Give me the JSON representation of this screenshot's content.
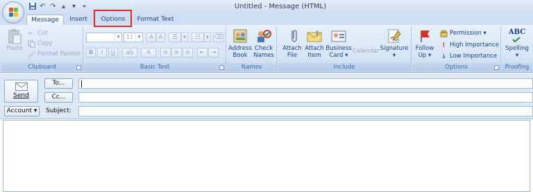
{
  "window": {
    "title": "Untitled - Message (HTML)"
  },
  "quick_access": {
    "icons": [
      "save-icon",
      "undo-icon",
      "redo-icon",
      "up-icon",
      "down-icon",
      "customize-icon"
    ]
  },
  "tabs": [
    {
      "label": "Message",
      "active": true
    },
    {
      "label": "Insert"
    },
    {
      "label": "Options",
      "highlighted": true
    },
    {
      "label": "Format Text"
    }
  ],
  "ribbon": {
    "clipboard": {
      "label": "Clipboard",
      "paste": "Paste",
      "cut": "Cut",
      "copy": "Copy",
      "format_painter": "Format Painter"
    },
    "basic_text": {
      "label": "Basic Text",
      "font_size": "11",
      "bold": "B",
      "italic": "I",
      "underline": "U"
    },
    "names": {
      "label": "Names",
      "address_book": "Address\nBook",
      "address_book_l1": "Address",
      "address_book_l2": "Book",
      "check_names_l1": "Check",
      "check_names_l2": "Names"
    },
    "include": {
      "label": "Include",
      "attach_file_l1": "Attach",
      "attach_file_l2": "File",
      "attach_item_l1": "Attach",
      "attach_item_l2": "Item",
      "business_card_l1": "Business",
      "business_card_l2": "Card ▾",
      "calendar": "Calendar",
      "signature_l1": "Signature",
      "signature_l2": "▾"
    },
    "options": {
      "label": "Options",
      "follow_up_l1": "Follow",
      "follow_up_l2": "Up ▾",
      "permission": "Permission ▾",
      "high_importance": "High Importance",
      "low_importance": "Low Importance"
    },
    "proofing": {
      "label": "Proofing",
      "spelling_l1": "Spelling",
      "spelling_l2": "▾",
      "abc": "ABC"
    }
  },
  "header": {
    "send": "Send",
    "to": "To...",
    "cc": "Cc...",
    "account": "Account ▾",
    "subject": "Subject:"
  },
  "colors": {
    "accent": "#15428b",
    "ribbon_bg": "#d9e6f6",
    "highlight": "#e8232b"
  }
}
